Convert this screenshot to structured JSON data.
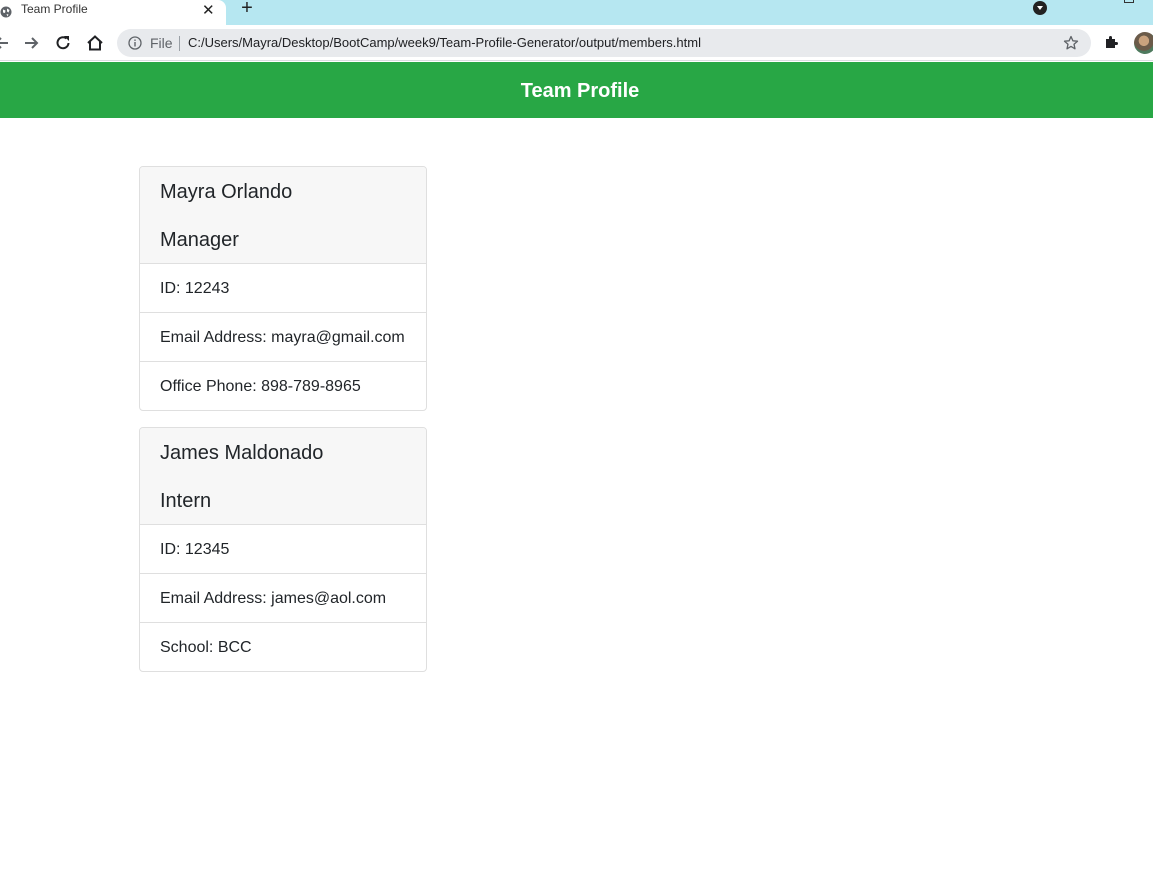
{
  "browser": {
    "tab_title": "Team Profile",
    "omnibox": {
      "scheme_label": "File",
      "url": "C:/Users/Mayra/Desktop/BootCamp/week9/Team-Profile-Generator/output/members.html"
    }
  },
  "page": {
    "header_title": "Team Profile",
    "accent_color": "#28a745"
  },
  "members": [
    {
      "name": "Mayra Orlando",
      "role": "Manager",
      "id": "ID: 12243",
      "email": "Email Address: mayra@gmail.com",
      "extra": "Office Phone: 898-789-8965"
    },
    {
      "name": "James Maldonado",
      "role": "Intern",
      "id": "ID: 12345",
      "email": "Email Address: james@aol.com",
      "extra": "School: BCC"
    }
  ]
}
